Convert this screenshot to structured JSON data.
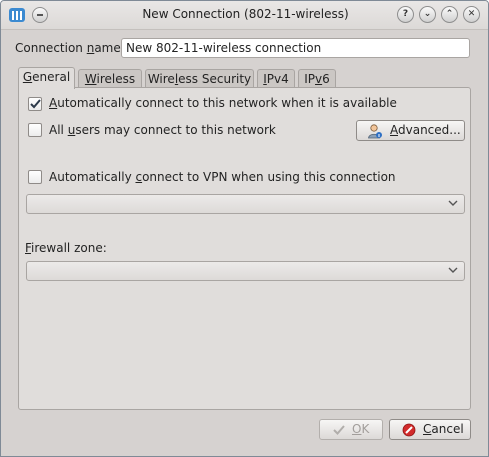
{
  "window": {
    "title": "New Connection (802-11-wireless)"
  },
  "connection_name": {
    "label_pre": "Connection ",
    "label_key": "n",
    "label_post": "ame:",
    "value": "New 802-11-wireless connection"
  },
  "tabs": [
    {
      "pre": "",
      "key": "G",
      "post": "eneral",
      "active": true
    },
    {
      "pre": "",
      "key": "W",
      "post": "ireless"
    },
    {
      "pre": "Wire",
      "key": "l",
      "post": "ess Security"
    },
    {
      "pre": "",
      "key": "I",
      "post": "Pv4"
    },
    {
      "pre": "IP",
      "key": "v",
      "post": "6"
    }
  ],
  "general": {
    "auto_connect": {
      "pre": "",
      "key": "A",
      "post": "utomatically connect to this network when it is available",
      "checked": true
    },
    "all_users": {
      "pre": "All ",
      "key": "u",
      "post": "sers may connect to this network",
      "checked": false
    },
    "advanced_button": {
      "pre": "",
      "key": "A",
      "post": "dvanced..."
    },
    "auto_vpn": {
      "pre": "Automatically ",
      "key": "c",
      "post": "onnect to VPN when using this connection",
      "checked": false
    },
    "vpn_combo": {
      "value": ""
    },
    "firewall_label": {
      "pre": "",
      "key": "F",
      "post": "irewall zone:"
    },
    "firewall_combo": {
      "value": ""
    }
  },
  "buttons": {
    "ok": {
      "pre": "",
      "key": "O",
      "post": "K",
      "enabled": false
    },
    "cancel": {
      "pre": "",
      "key": "C",
      "post": "ancel"
    }
  }
}
